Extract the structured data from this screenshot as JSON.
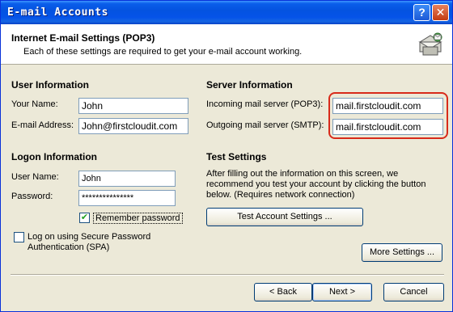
{
  "window": {
    "title": "E-mail Accounts",
    "help_glyph": "?",
    "close_glyph": "✕"
  },
  "header": {
    "title": "Internet E-mail Settings (POP3)",
    "subtitle": "Each of these settings are required to get your e-mail account working.",
    "icon": "email-settings-icon"
  },
  "user_info": {
    "section_title": "User Information",
    "name_label": "Your Name:",
    "name_value": "John",
    "email_label": "E-mail Address:",
    "email_value": "John@firstcloudit.com"
  },
  "logon_info": {
    "section_title": "Logon Information",
    "username_label": "User Name:",
    "username_value": "John",
    "password_label": "Password:",
    "password_value": "***************",
    "remember_label": "Remember password",
    "remember_checked": true,
    "spa_label_line1": "Log on using Secure Password",
    "spa_label_line2": "Authentication (SPA)",
    "spa_checked": false
  },
  "server_info": {
    "section_title": "Server Information",
    "incoming_label": "Incoming mail server (POP3):",
    "incoming_value": "mail.firstcloudit.com",
    "outgoing_label": "Outgoing mail server (SMTP):",
    "outgoing_value": "mail.firstcloudit.com",
    "highlight_color": "#d82a1a"
  },
  "test_settings": {
    "section_title": "Test Settings",
    "description": "After filling out the information on this screen, we recommend you test your account by clicking the button below. (Requires network connection)",
    "test_button_label": "Test Account Settings ..."
  },
  "footer": {
    "more_settings_label": "More Settings ...",
    "back_label": "< Back",
    "next_label": "Next >",
    "cancel_label": "Cancel"
  }
}
